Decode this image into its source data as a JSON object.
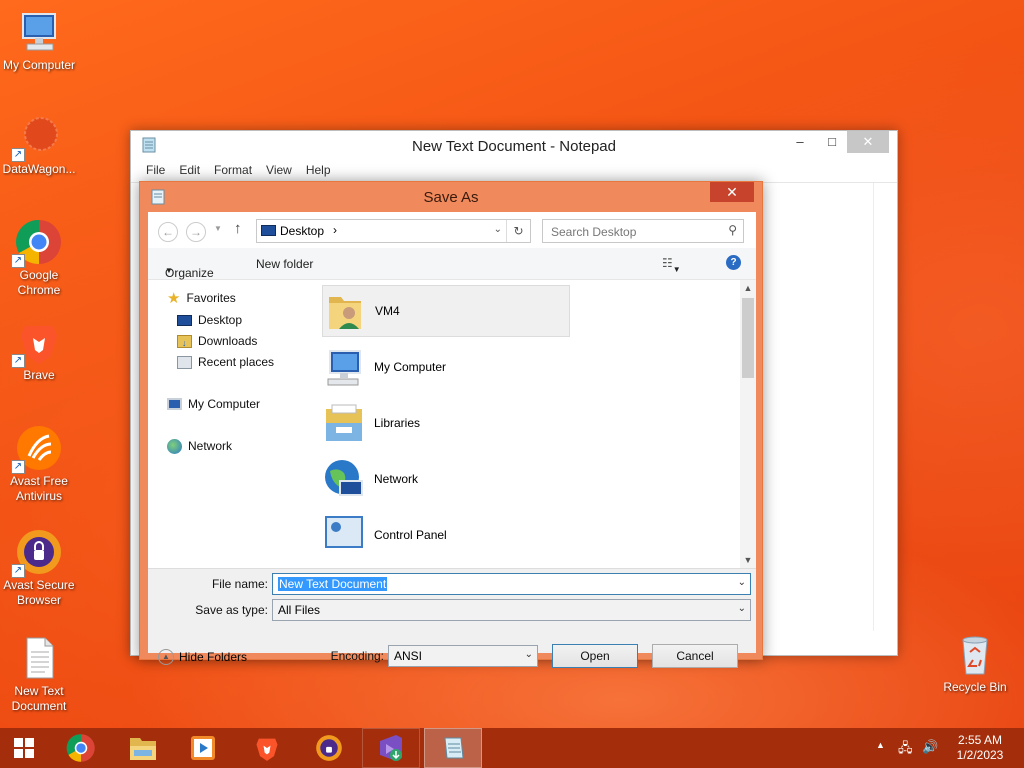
{
  "desktop": {
    "icons": [
      {
        "label": "My Computer",
        "icon": "computer-icon"
      },
      {
        "label": "DataWagon...",
        "icon": "datawagon-icon"
      },
      {
        "label": "Google Chrome",
        "icon": "chrome-icon"
      },
      {
        "label": "Brave",
        "icon": "brave-icon"
      },
      {
        "label": "Avast Free Antivirus",
        "icon": "avast-icon"
      },
      {
        "label": "Avast Secure Browser",
        "icon": "avast-browser-icon"
      },
      {
        "label": "New Text Document",
        "icon": "text-document-icon"
      }
    ],
    "recycle_bin": "Recycle Bin"
  },
  "notepad": {
    "title": "New Text Document - Notepad",
    "menu": [
      "File",
      "Edit",
      "Format",
      "View",
      "Help"
    ],
    "controls": {
      "minimize": "–",
      "maximize": "□",
      "close": "✕"
    }
  },
  "save_dialog": {
    "title": "Save As",
    "close": "✕",
    "path": "Desktop",
    "path_arrow": "›",
    "search_placeholder": "Search Desktop",
    "organize": "Organize",
    "new_folder": "New folder",
    "nav": {
      "favorites": "Favorites",
      "favorites_items": [
        "Desktop",
        "Downloads",
        "Recent places"
      ],
      "my_computer": "My Computer",
      "network": "Network"
    },
    "files": [
      "VM4",
      "My Computer",
      "Libraries",
      "Network",
      "Control Panel"
    ],
    "file_name_label": "File name:",
    "file_name_value": "New Text Document",
    "save_as_type_label": "Save as type:",
    "save_as_type_value": "All Files",
    "hide_folders": "Hide Folders",
    "encoding_label": "Encoding:",
    "encoding_value": "ANSI",
    "open_button": "Open",
    "cancel_button": "Cancel"
  },
  "taskbar": {
    "clock_time": "2:55 AM",
    "clock_date": "1/2/2023"
  },
  "colors": {
    "dialog_frame": "#f08a5d",
    "taskbar": "#a42e0b",
    "selection": "#3399ff"
  }
}
